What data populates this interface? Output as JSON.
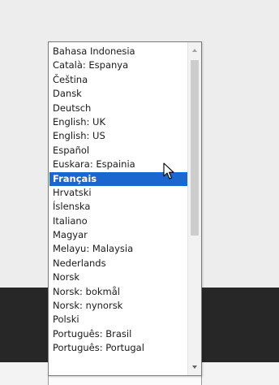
{
  "language_dropdown": {
    "items": [
      "Bahasa Indonesia",
      "Català: Espanya",
      "Čeština",
      "Dansk",
      "Deutsch",
      "English: UK",
      "English: US",
      "Español",
      "Euskara: Espainia",
      "Français",
      "Hrvatski",
      "Íslenska",
      "Italiano",
      "Magyar",
      "Melayu: Malaysia",
      "Nederlands",
      "Norsk",
      "Norsk: bokmål",
      "Norsk: nynorsk",
      "Polski",
      "Português: Brasil",
      "Português: Portugal"
    ],
    "selected": "Français",
    "selected_color": "#1a67cf"
  },
  "icons": {
    "scroll_up": "scroll-up-arrow-icon",
    "scroll_down": "scroll-down-arrow-icon",
    "cursor": "mouse-pointer-icon"
  }
}
